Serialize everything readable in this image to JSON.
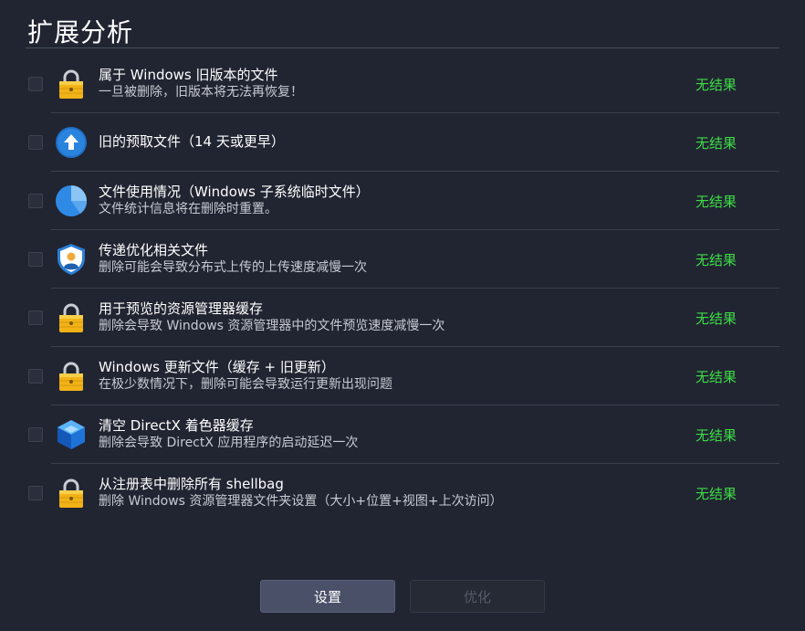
{
  "header": {
    "title": "扩展分析"
  },
  "items": [
    {
      "icon": "lock-icon",
      "title": "属于 Windows 旧版本的文件",
      "desc": "一旦被删除，旧版本将无法再恢复！",
      "result": "无结果"
    },
    {
      "icon": "upload-arrow-icon",
      "title": "旧的预取文件（14 天或更早）",
      "desc": "",
      "result": "无结果"
    },
    {
      "icon": "pie-chart-icon",
      "title": "文件使用情况（Windows 子系统临时文件）",
      "desc": "文件统计信息将在删除时重置。",
      "result": "无结果"
    },
    {
      "icon": "user-shield-icon",
      "title": "传递优化相关文件",
      "desc": "删除可能会导致分布式上传的上传速度减慢一次",
      "result": "无结果"
    },
    {
      "icon": "lock-icon",
      "title": "用于预览的资源管理器缓存",
      "desc": "删除会导致 Windows 资源管理器中的文件预览速度减慢一次",
      "result": "无结果"
    },
    {
      "icon": "lock-icon",
      "title": "Windows 更新文件（缓存 + 旧更新）",
      "desc": "在极少数情况下，删除可能会导致运行更新出现问题",
      "result": "无结果"
    },
    {
      "icon": "directx-cube-icon",
      "title": "清空 DirectX 着色器缓存",
      "desc": "删除会导致 DirectX 应用程序的启动延迟一次",
      "result": "无结果"
    },
    {
      "icon": "lock-icon",
      "title": "从注册表中删除所有 shellbag",
      "desc": "删除 Windows 资源管理器文件夹设置（大小+位置+视图+上次访问）",
      "result": "无结果"
    }
  ],
  "buttons": {
    "settings": "设置",
    "optimize": "优化"
  },
  "colors": {
    "result_green": "#3ddc45",
    "background": "#212532"
  }
}
